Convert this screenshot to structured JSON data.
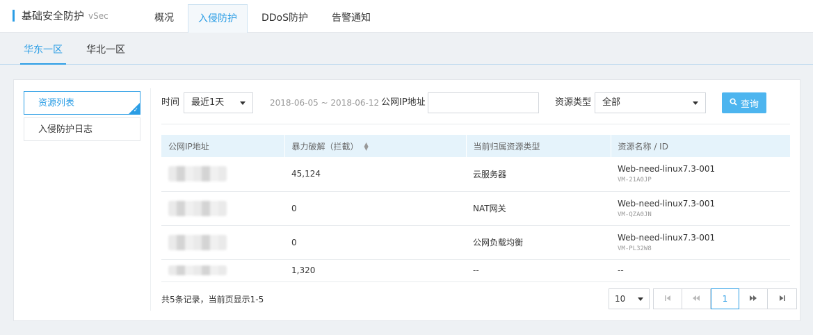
{
  "header": {
    "title": "基础安全防护",
    "subtitle": "vSec",
    "tabs": [
      {
        "label": "概况"
      },
      {
        "label": "入侵防护"
      },
      {
        "label": "DDoS防护"
      },
      {
        "label": "告警通知"
      }
    ],
    "active_tab": "入侵防护"
  },
  "regions": {
    "tabs": [
      {
        "label": "华东一区"
      },
      {
        "label": "华北一区"
      }
    ],
    "active": "华东一区"
  },
  "sidebar": {
    "items": [
      {
        "label": "资源列表",
        "active": true
      },
      {
        "label": "入侵防护日志",
        "active": false
      }
    ]
  },
  "filters": {
    "time_label": "时间",
    "time_value": "最近1天",
    "date_range": "2018-06-05 ~ 2018-06-12",
    "ip_label": "公网IP地址",
    "ip_value": "",
    "type_label": "资源类型",
    "type_value": "全部",
    "search_label": "查询"
  },
  "table": {
    "columns": [
      "公网IP地址",
      "暴力破解（拦截）",
      "当前归属资源类型",
      "资源名称 / ID"
    ],
    "rows": [
      {
        "ip": "",
        "count": "45,124",
        "type": "云服务器",
        "name": "Web-need-linux7.3-001",
        "id": "VM-21A0JP"
      },
      {
        "ip": "",
        "count": "0",
        "type": "NAT网关",
        "name": "Web-need-linux7.3-001",
        "id": "VM-QZA0JN"
      },
      {
        "ip": "",
        "count": "0",
        "type": "公网负载均衡",
        "name": "Web-need-linux7.3-001",
        "id": "VM-PL32W8"
      },
      {
        "ip": "",
        "count": "1,320",
        "type": "--",
        "name": "--",
        "id": ""
      }
    ]
  },
  "footer": {
    "records_text": "共5条记录，当前页显示1-5",
    "page_size": "10",
    "current_page": "1"
  },
  "colors": {
    "accent": "#2a9de5",
    "button": "#4db5ef",
    "table_header_bg": "#e5f3fb"
  }
}
